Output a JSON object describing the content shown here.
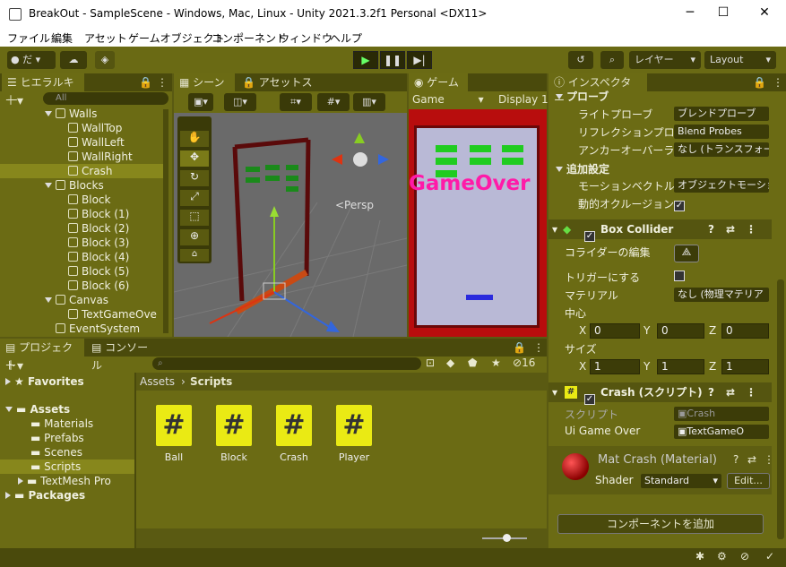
{
  "window": {
    "title": "BreakOut - SampleScene - Windows, Mac, Linux - Unity 2021.3.2f1 Personal <DX11>"
  },
  "menu": [
    "ファイル",
    "編集",
    "アセット",
    "ゲームオブジェクト",
    "コンポーネント",
    "ウィンドウ",
    "ヘルプ"
  ],
  "toolbar": {
    "account": "だ",
    "layers": "レイヤー",
    "layout": "Layout"
  },
  "tabs": {
    "hierarchy": "ヒエラルキー",
    "scene": "シーン",
    "asset_store": "アセットストア",
    "game": "ゲーム",
    "inspector": "インスペクター",
    "project": "プロジェクト",
    "console": "コンソール"
  },
  "hierarchy": {
    "search_placeholder": "All",
    "items": [
      {
        "label": "Walls"
      },
      {
        "label": "WallTop"
      },
      {
        "label": "WallLeft"
      },
      {
        "label": "WallRight"
      },
      {
        "label": "Crash"
      },
      {
        "label": "Blocks"
      },
      {
        "label": "Block"
      },
      {
        "label": "Block (1)"
      },
      {
        "label": "Block (2)"
      },
      {
        "label": "Block (3)"
      },
      {
        "label": "Block (4)"
      },
      {
        "label": "Block (5)"
      },
      {
        "label": "Block (6)"
      },
      {
        "label": "Canvas"
      },
      {
        "label": "TextGameOve"
      },
      {
        "label": "EventSystem"
      }
    ]
  },
  "scene": {
    "persp_label": "<Persp"
  },
  "game": {
    "display_select": "Game",
    "display": "Display 1",
    "overlay_text": "GameOver"
  },
  "inspector": {
    "probes_header": "プローブ",
    "light_probe_label": "ライトプローブ",
    "light_probe_value": "ブレンドプローブ",
    "reflection_label": "リフレクションプローブ",
    "reflection_value": "Blend Probes",
    "anchor_label": "アンカーオーバーライド",
    "anchor_value": "なし (トランスフォー",
    "additional_header": "追加設定",
    "motion_label": "モーションベクトル",
    "motion_value": "オブジェクトモーショ",
    "dynamic_occlusion_label": "動的オクルージョン",
    "box_collider_title": "Box Collider",
    "edit_collider_label": "コライダーの編集",
    "is_trigger_label": "トリガーにする",
    "material_label": "マテリアル",
    "material_value": "なし (物理マテリア",
    "center_label": "中心",
    "size_label": "サイズ",
    "center": {
      "x": "0",
      "y": "0",
      "z": "0"
    },
    "size": {
      "x": "1",
      "y": "1",
      "z": "1"
    },
    "axis_x": "X",
    "axis_y": "Y",
    "axis_z": "Z",
    "crash_script_title": "Crash (スクリプト)",
    "script_label": "スクリプト",
    "script_value": "Crash",
    "ui_gameover_label": "Ui Game Over",
    "ui_gameover_value": "TextGameO",
    "material_title": "Mat Crash (Material)",
    "shader_label": "Shader",
    "shader_value": "Standard",
    "edit_button": "Edit...",
    "add_component": "コンポーネントを追加"
  },
  "project": {
    "favorites": "Favorites",
    "assets": "Assets",
    "folders": [
      "Materials",
      "Prefabs",
      "Scenes",
      "Scripts",
      "TextMesh Pro"
    ],
    "packages": "Packages",
    "breadcrumb_root": "Assets",
    "breadcrumb_current": "Scripts",
    "files": [
      "Ball",
      "Block",
      "Crash",
      "Player"
    ],
    "hidden_count": "16"
  },
  "colors": {
    "accent_yellow": "#eaea14",
    "gameover_pink": "#ff1aa8",
    "game_bg": "#b8b8d8",
    "block_green": "#22cc22"
  }
}
